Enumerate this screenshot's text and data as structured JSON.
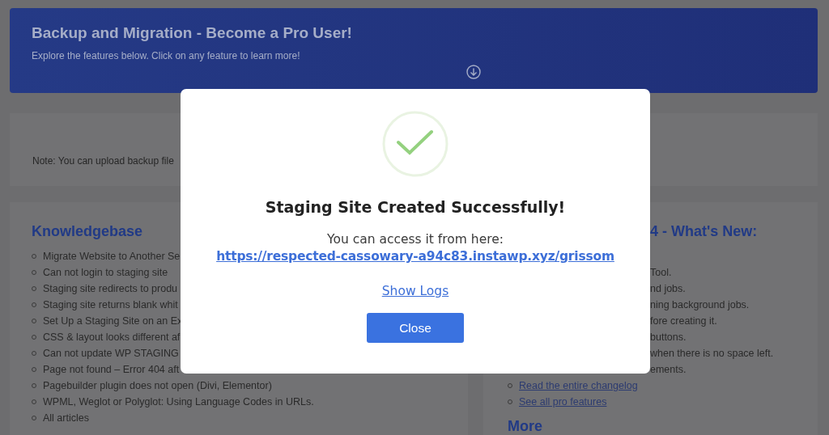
{
  "banner": {
    "title": "Backup and Migration - Become a Pro User!",
    "subtitle": "Explore the features below. Click on any feature to learn more!"
  },
  "note": "Note: You can upload backup file",
  "knowledgebase": {
    "title": "Knowledgebase",
    "items": [
      "Migrate Website to Another Se",
      "Can not login to staging site",
      "Staging site redirects to produ",
      "Staging site returns blank whit",
      "Set Up a Staging Site on an Ex",
      "CSS & layout looks different af",
      "Can not update WP STAGING",
      "Page not found – Error 404 aft",
      "Pagebuilder plugin does not open (Divi, Elementor)",
      "WPML, Weglot or Polyglot: Using Language Codes in URLs.",
      "All articles"
    ]
  },
  "whats_new": {
    "title": "4 - What's New:",
    "items": [
      {
        "kind": "covered",
        "text": "Tool."
      },
      {
        "kind": "covered",
        "text": "nd jobs."
      },
      {
        "kind": "covered",
        "text": "ning background jobs."
      },
      {
        "kind": "covered",
        "text": "fore creating it."
      },
      {
        "kind": "covered",
        "text": "buttons."
      },
      {
        "kind": "covered",
        "text": "when there is no space left."
      },
      {
        "kind": "covered",
        "text": "ements."
      },
      {
        "kind": "link",
        "text": "Read the entire changelog"
      },
      {
        "kind": "link",
        "text": "See all pro features"
      }
    ],
    "more": "More"
  },
  "modal": {
    "title": "Staging Site Created Successfully!",
    "message": "You can access it from here:",
    "url": "https://respected-cassowary-a94c83.instawp.xyz/grissom",
    "show_logs": "Show Logs",
    "close": "Close"
  }
}
